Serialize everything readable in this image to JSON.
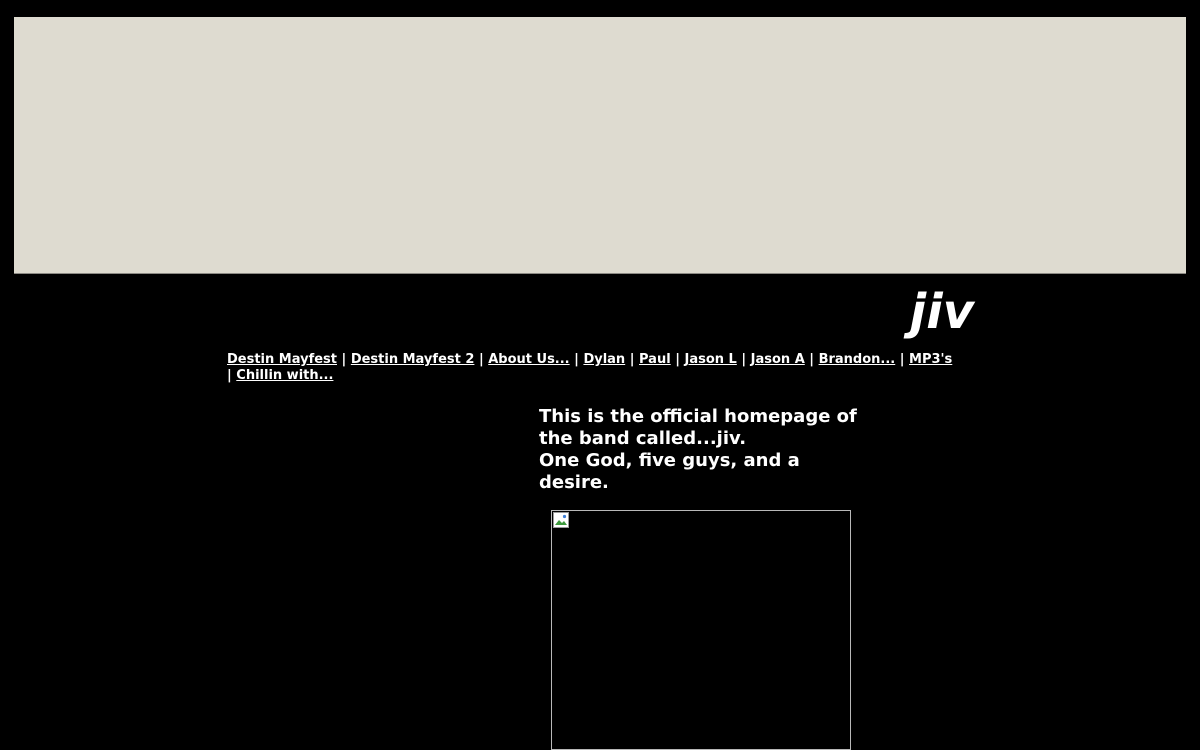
{
  "colors": {
    "page_background": "#000000",
    "banner_background": "#dedbd0",
    "text": "#ffffff",
    "photo_border": "#b9b9b9"
  },
  "header": {
    "site_title": "jiv"
  },
  "nav": {
    "items": [
      {
        "label": "Destin Mayfest"
      },
      {
        "label": "Destin Mayfest 2"
      },
      {
        "label": "About Us..."
      },
      {
        "label": "Dylan"
      },
      {
        "label": "Paul"
      },
      {
        "label": "Jason L"
      },
      {
        "label": "Jason A"
      },
      {
        "label": "Brandon..."
      },
      {
        "label": "MP3's"
      },
      {
        "label": "Chillin with..."
      }
    ],
    "separator": "|"
  },
  "main": {
    "intro_line1": "This is the official homepage of the band called...jiv.",
    "intro_line2": "One God, five guys, and a desire."
  },
  "photo": {
    "icon": "broken-image-icon"
  }
}
